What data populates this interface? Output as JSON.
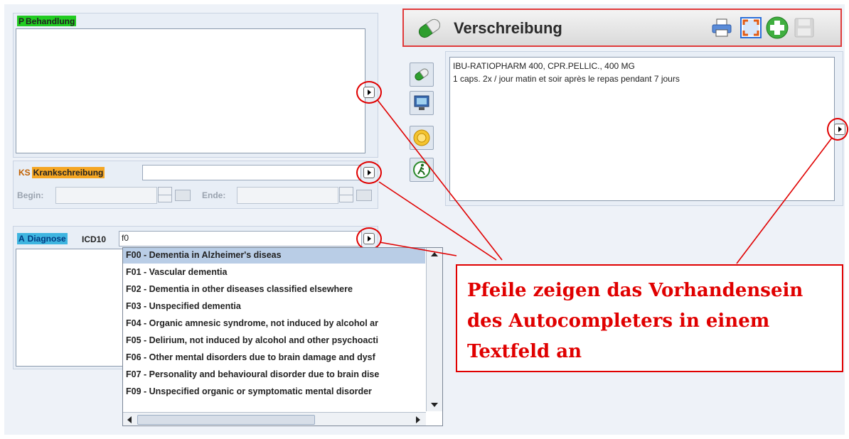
{
  "behandlung": {
    "prefix": "P",
    "label": "Behandlung"
  },
  "krankschreibung": {
    "prefix": "KS",
    "label": "Krankschreibung",
    "begin_label": "Begin:",
    "ende_label": "Ende:"
  },
  "diagnose": {
    "prefix": "A",
    "label": "Diagnose",
    "code_label": "ICD10",
    "input_value": "f0",
    "suggestions": [
      "F00 -  Dementia in Alzheimer's diseas",
      "F01 -  Vascular dementia",
      "F02 - Dementia in other diseases classified elsewhere",
      "F03 - Unspecified dementia",
      "F04 - Organic amnesic syndrome, not induced by alcohol ar",
      "F05 - Delirium, not induced by alcohol and other psychoacti",
      "F06 - Other mental disorders due to brain damage and dysf",
      "F07 - Personality and behavioural disorder due to brain dise",
      "F09 - Unspecified organic or symptomatic mental disorder"
    ]
  },
  "verschreibung": {
    "title": "Verschreibung",
    "line1": "IBU-RATIOPHARM 400, CPR.PELLIC., 400 MG",
    "line2": "1 caps. 2x / jour matin et soir après le repas pendant 7 jours"
  },
  "annotation": {
    "line1": "Pfeile zeigen das Vorhandensein",
    "line2": "des Autocompleters in einem",
    "line3": "Textfeld an"
  },
  "colors": {
    "behandlung_hl": "#22cc22",
    "krankschreibung_hl": "#f5a623",
    "diagnose_hl": "#3fb5e0",
    "annotation_red": "#e00000"
  }
}
